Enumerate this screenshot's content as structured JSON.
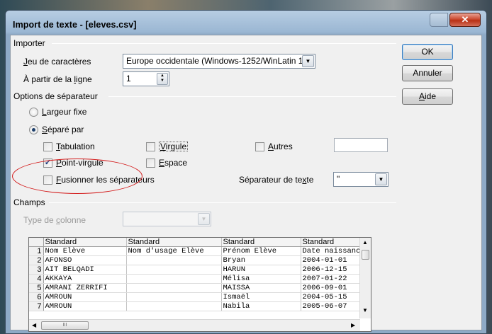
{
  "window": {
    "title": "Import de texte - [eleves.csv]",
    "close_glyph": "✕"
  },
  "importer": {
    "section": "Importer",
    "charset_label_u": "J",
    "charset_label_rest": "eu de caractères",
    "charset_value": "Europe occidentale (Windows-1252/WinLatin 1)",
    "fromline_label_pre": "À partir de la ",
    "fromline_label_u": "l",
    "fromline_label_rest": "igne",
    "fromline_value": "1"
  },
  "separator": {
    "section": "Options de séparateur",
    "fixed_u": "L",
    "fixed_rest": "argeur fixe",
    "fixed_selected": false,
    "separated_u": "S",
    "separated_rest": "éparé par",
    "separated_selected": true,
    "tab_u": "T",
    "tab_rest": "abulation",
    "tab_checked": false,
    "comma_u": "V",
    "comma_rest": "irgule",
    "comma_checked": false,
    "other_u": "A",
    "other_rest": "utres",
    "other_checked": false,
    "other_value": "",
    "semicolon_u": "P",
    "semicolon_rest": "oint-virgule",
    "semicolon_checked": true,
    "space_u": "E",
    "space_rest": "space",
    "space_checked": false,
    "merge_u": "F",
    "merge_rest": "usionner les séparateurs",
    "merge_checked": false,
    "textsep_label_pre": "Séparateur de te",
    "textsep_label_u": "x",
    "textsep_label_rest": "te",
    "textsep_value": "\""
  },
  "fields": {
    "section": "Champs",
    "coltype_label_pre": "Type de ",
    "coltype_label_u": "c",
    "coltype_label_rest": "olonne",
    "coltype_value": "",
    "headers": [
      "Standard",
      "Standard",
      "Standard",
      "Standard"
    ],
    "rows": [
      [
        "1",
        "Nom Elève",
        "Nom d'usage Elève",
        "Prénom Elève",
        "Date naissanc"
      ],
      [
        "2",
        "AFONSO",
        "",
        "Bryan",
        "2004-01-01"
      ],
      [
        "3",
        "AIT BELQADI",
        "",
        "HARUN",
        "2006-12-15"
      ],
      [
        "4",
        "AKKAYA",
        "",
        "Mélisa",
        "2007-01-22"
      ],
      [
        "5",
        "AMRANI ZERRIFI",
        "",
        "MAISSA",
        "2006-09-01"
      ],
      [
        "6",
        "AMROUN",
        "",
        "Ismaël",
        "2004-05-15"
      ],
      [
        "7",
        "AMROUN",
        "",
        "Nabila",
        "2005-06-07"
      ]
    ],
    "hscroll_thumb": "III"
  },
  "buttons": {
    "ok": "OK",
    "cancel": "Annuler",
    "help_u": "A",
    "help_rest": "ide"
  },
  "icons": {
    "dropdown": "▼",
    "spin_up": "▲",
    "spin_down": "▼",
    "scroll_up": "▲",
    "scroll_down": "▼",
    "scroll_left": "◀",
    "scroll_right": "▶",
    "check": "✓"
  },
  "colors": {
    "annotation": "#d31a1a",
    "default_button_border": "#3b7bbd"
  }
}
